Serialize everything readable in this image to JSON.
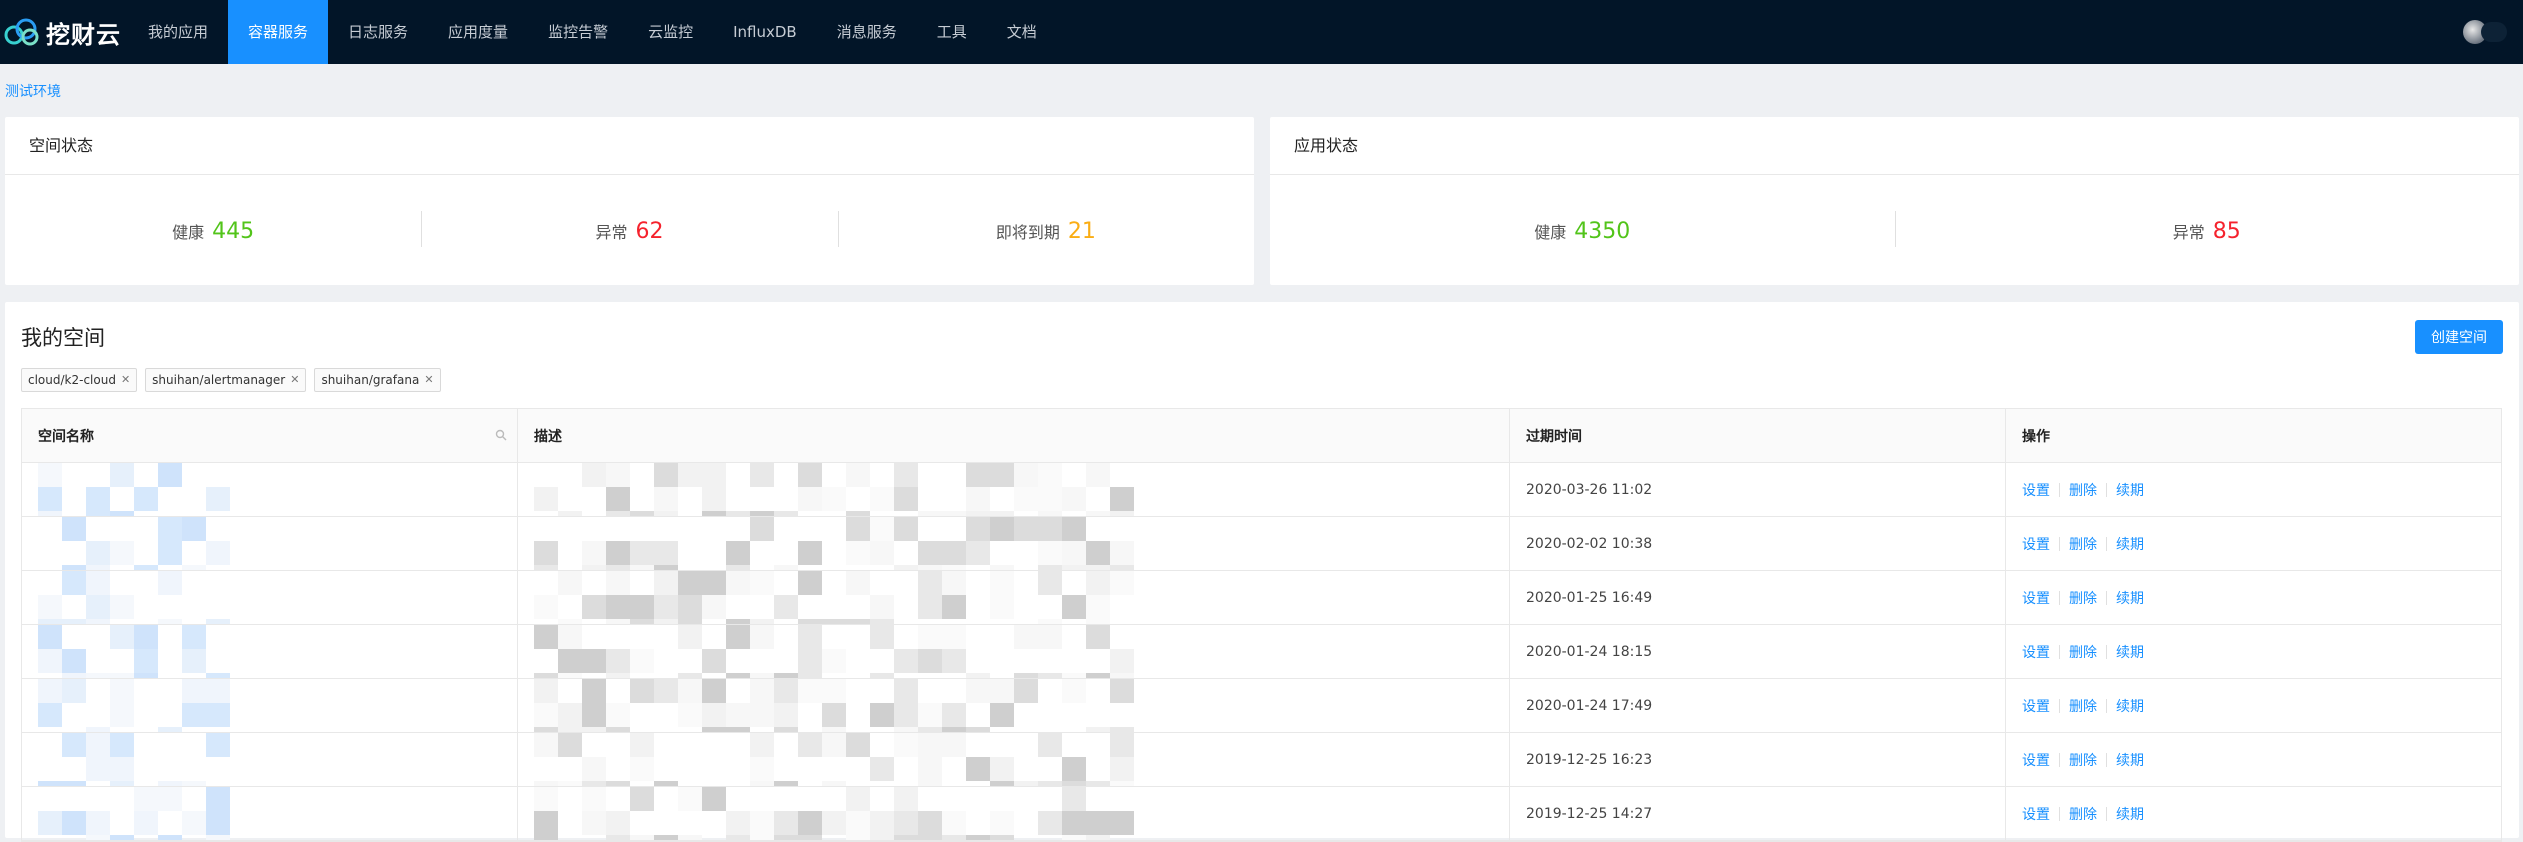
{
  "brand": {
    "name": "挖财云"
  },
  "nav": {
    "items": [
      {
        "label": "我的应用"
      },
      {
        "label": "容器服务",
        "active": true
      },
      {
        "label": "日志服务"
      },
      {
        "label": "应用度量"
      },
      {
        "label": "监控告警"
      },
      {
        "label": "云监控"
      },
      {
        "label": "InfluxDB"
      },
      {
        "label": "消息服务"
      },
      {
        "label": "工具"
      },
      {
        "label": "文档"
      }
    ]
  },
  "env_link": "测试环境",
  "space_status": {
    "title": "空间状态",
    "stats": [
      {
        "label": "健康",
        "value": "445",
        "color": "#52c41a"
      },
      {
        "label": "异常",
        "value": "62",
        "color": "#f5222d"
      },
      {
        "label": "即将到期",
        "value": "21",
        "color": "#faad14"
      }
    ]
  },
  "app_status": {
    "title": "应用状态",
    "stats": [
      {
        "label": "健康",
        "value": "4350",
        "color": "#52c41a"
      },
      {
        "label": "异常",
        "value": "85",
        "color": "#f5222d"
      }
    ]
  },
  "my_spaces": {
    "title": "我的空间",
    "create_button": "创建空间",
    "tags": [
      "cloud/k2-cloud",
      "shuihan/alertmanager",
      "shuihan/grafana"
    ],
    "columns": [
      "空间名称",
      "描述",
      "过期时间",
      "操作"
    ],
    "rows": [
      {
        "expire": "2020-03-26 11:02"
      },
      {
        "expire": "2020-02-02 10:38"
      },
      {
        "expire": "2020-01-25 16:49"
      },
      {
        "expire": "2020-01-24 18:15"
      },
      {
        "expire": "2020-01-24 17:49"
      },
      {
        "expire": "2019-12-25 16:23"
      },
      {
        "expire": "2019-12-25 14:27"
      }
    ],
    "actions": [
      "设置",
      "删除",
      "续期"
    ]
  },
  "colors": {
    "accent": "#1890ff",
    "nav_bg": "#021528"
  }
}
